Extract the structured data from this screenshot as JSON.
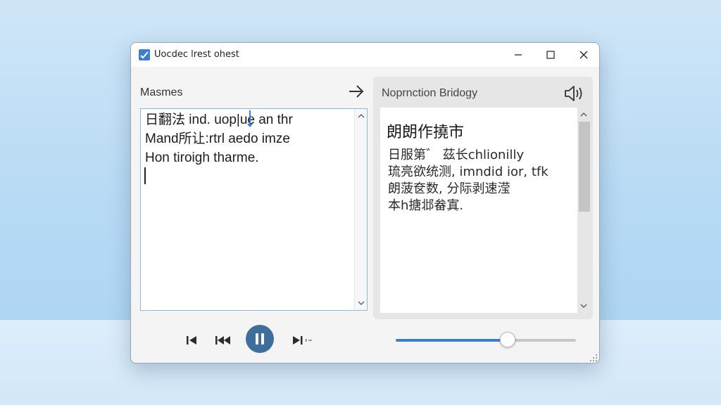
{
  "window": {
    "title": "Uocdec lrest ohest",
    "icon": "app-translate-icon",
    "buttons": [
      "minimize-icon",
      "maximize-icon",
      "close-icon"
    ]
  },
  "source": {
    "label": "Masmes",
    "lines": [
      "日翻法 ind. uop|ue an thr",
      "Mand所让:rtrl aedo imze",
      "Hon tiroigh tharme."
    ]
  },
  "target": {
    "label": "Noprnction Bridogy",
    "heading": "朗朗作撓市",
    "lines": [
      "日服第゛ 茲长chlionilly",
      "琉亮欲统测, imndid ior, tfk",
      "朗菠奁数, 分际剥速滢",
      "本h搪邶畚寘."
    ]
  },
  "player": {
    "progress_fraction": 0.62,
    "accent": "#3d7fcf",
    "play_button_color": "#3e6e9c"
  }
}
